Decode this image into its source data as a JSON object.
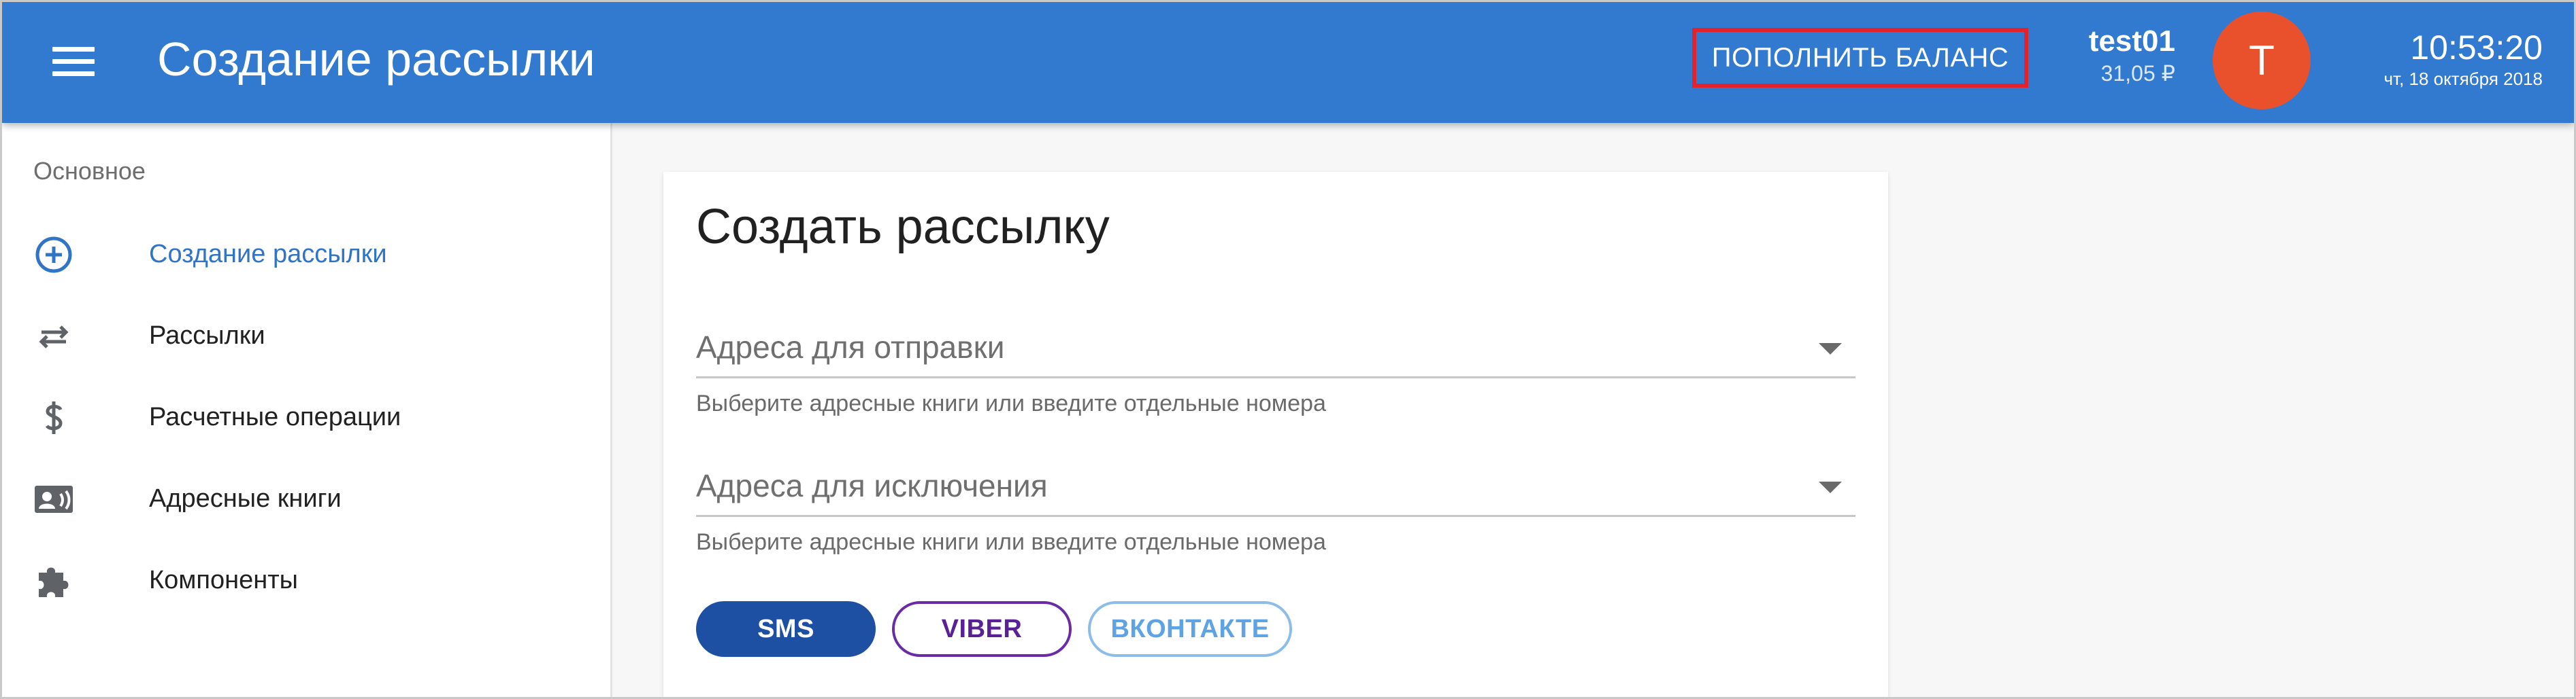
{
  "header": {
    "menu_icon": "menu-icon",
    "title": "Создание рассылки",
    "topup_label": "ПОПОЛНИТЬ БАЛАНС",
    "topup_highlight_color": "#e3222b",
    "username": "test01",
    "balance": "31,05 ₽",
    "avatar_letter": "T",
    "time": "10:53:20",
    "date": "чт, 18 октября 2018",
    "bar_color": "#3279d0"
  },
  "sidebar": {
    "section": "Основное",
    "items": [
      {
        "label": "Создание рассылки",
        "icon": "add-circle-icon",
        "active": true
      },
      {
        "label": "Рассылки",
        "icon": "swap-arrows-icon",
        "active": false
      },
      {
        "label": "Расчетные операции",
        "icon": "dollar-icon",
        "active": false
      },
      {
        "label": "Адресные книги",
        "icon": "contact-card-icon",
        "active": false
      },
      {
        "label": "Компоненты",
        "icon": "puzzle-icon",
        "active": false
      }
    ]
  },
  "main": {
    "title": "Создать рассылку",
    "fields": [
      {
        "label": "Адреса для отправки",
        "hint": "Выберите адресные книги или введите отдельные номера"
      },
      {
        "label": "Адреса для исключения",
        "hint": "Выберите адресные книги или введите отдельные номера"
      }
    ],
    "channels": [
      {
        "label": "SMS",
        "selected": true
      },
      {
        "label": "VIBER",
        "selected": false
      },
      {
        "label": "ВКОНТАКТЕ",
        "selected": false
      }
    ]
  }
}
